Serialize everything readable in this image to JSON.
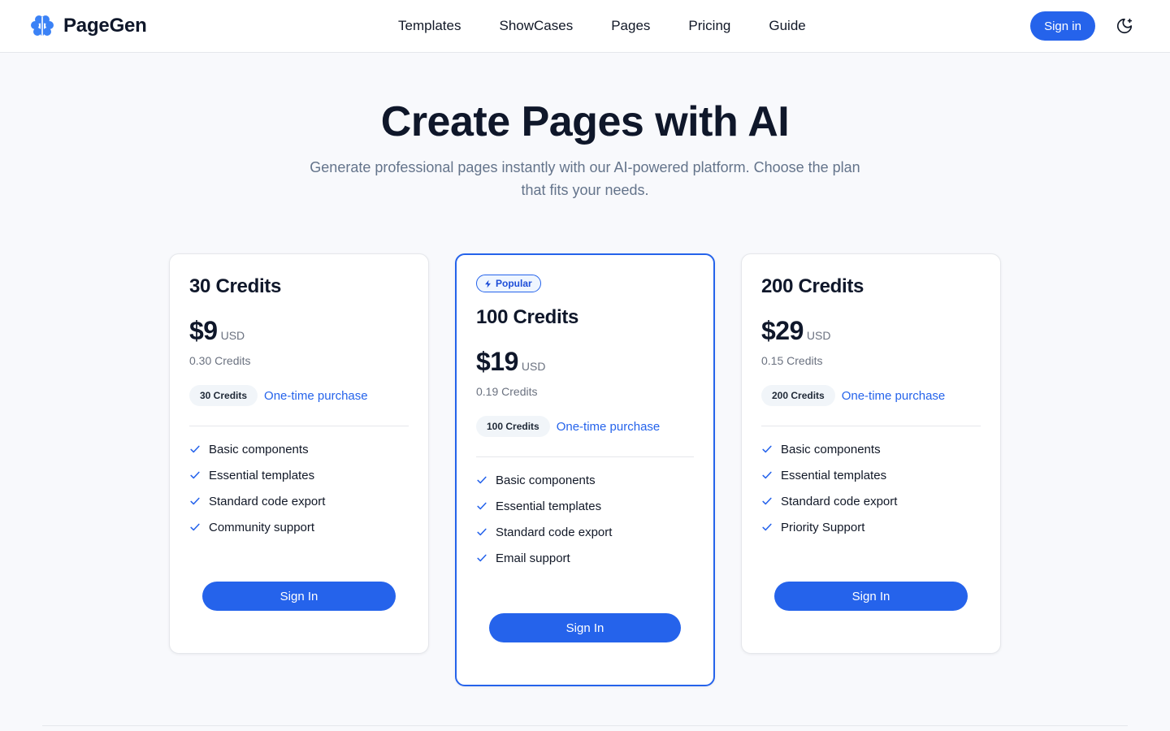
{
  "header": {
    "brand": "PageGen",
    "logo_icon": "brain-icon",
    "nav": [
      "Templates",
      "ShowCases",
      "Pages",
      "Pricing",
      "Guide"
    ],
    "sign_in": "Sign in",
    "theme_icon": "moon-stars-icon"
  },
  "hero": {
    "title": "Create Pages with AI",
    "subtitle": "Generate professional pages instantly with our AI-powered platform. Choose the plan that fits your needs."
  },
  "plans": [
    {
      "title": "30 Credits",
      "price": "$9",
      "currency": "USD",
      "per_credit": "0.30 Credits",
      "pill": "30 Credits",
      "purchase_type": "One-time purchase",
      "features": [
        "Basic components",
        "Essential templates",
        "Standard code export",
        "Community support"
      ],
      "button": "Sign In"
    },
    {
      "badge": "Popular",
      "badge_icon": "lightning-icon",
      "title": "100 Credits",
      "price": "$19",
      "currency": "USD",
      "per_credit": "0.19 Credits",
      "pill": "100 Credits",
      "purchase_type": "One-time purchase",
      "features": [
        "Basic components",
        "Essential templates",
        "Standard code export",
        "Email support"
      ],
      "button": "Sign In"
    },
    {
      "title": "200 Credits",
      "price": "$29",
      "currency": "USD",
      "per_credit": "0.15 Credits",
      "pill": "200 Credits",
      "purchase_type": "One-time purchase",
      "features": [
        "Basic components",
        "Essential templates",
        "Standard code export",
        "Priority Support"
      ],
      "button": "Sign In"
    }
  ],
  "colors": {
    "accent": "#2563eb",
    "background": "#f8f9fc",
    "text": "#0f172a",
    "muted": "#64748b"
  }
}
